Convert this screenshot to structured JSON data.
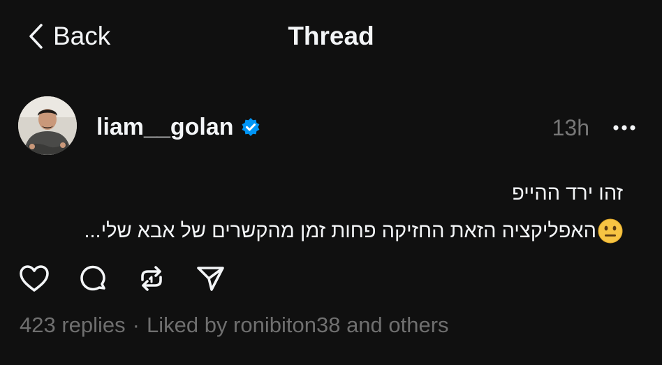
{
  "header": {
    "back_label": "Back",
    "title": "Thread"
  },
  "post": {
    "username": "liam__golan",
    "verified": true,
    "timestamp": "13h",
    "text_line1": "זהו ירד ההייפ",
    "text_line2": "האפליקציה הזאת החזיקה פחות זמן מהקשרים של אבא שלי...",
    "emoji": "neutral-face-emoji",
    "replies": "423 replies",
    "separator": "·",
    "liked_by": "Liked by ronibiton38 and others"
  },
  "icons": {
    "back": "chevron-left-icon",
    "verified": "verified-badge-icon",
    "more": "more-horizontal-icon",
    "like": "heart-icon",
    "comment": "comment-icon",
    "repost": "repost-icon",
    "share": "send-icon"
  },
  "colors": {
    "background": "#101010",
    "text": "#f3f5f7",
    "muted": "#777777",
    "verified": "#0095f6"
  }
}
